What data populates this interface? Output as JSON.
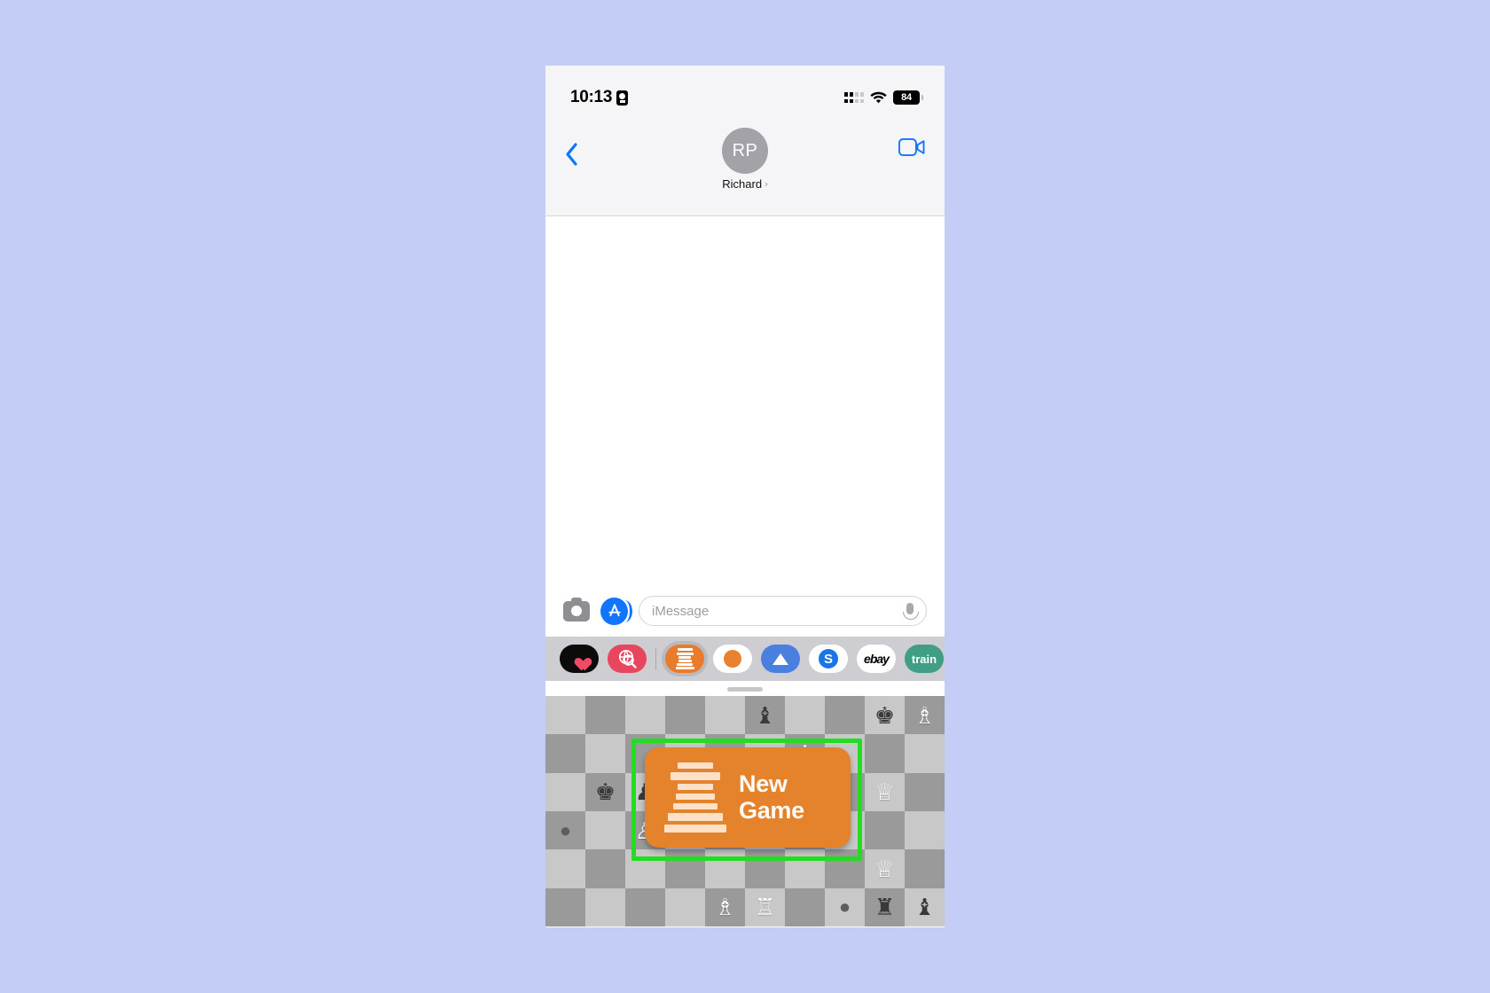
{
  "device": {
    "status_bar": {
      "time": "10:13",
      "time_icon": "record-badge-icon",
      "cellular_icon": "cellular-bars-icon",
      "wifi_icon": "wifi-icon",
      "battery_level": "84"
    },
    "home_indicator": "home-indicator"
  },
  "header": {
    "back_icon": "chevron-left-icon",
    "avatar_initials": "RP",
    "contact_name": "Richard",
    "contact_chevron": "›",
    "facetime_icon": "video-camera-icon"
  },
  "conversation": {
    "messages": []
  },
  "input_bar": {
    "camera_icon": "camera-icon",
    "appstore_icon": "app-store-icon",
    "message_placeholder": "iMessage",
    "message_value": "",
    "mic_icon": "microphone-icon"
  },
  "app_drawer": {
    "items": [
      {
        "name": "apple-music-icon",
        "label": "",
        "bg": "#0b0b0b",
        "selected": false
      },
      {
        "name": "app-store-search-icon",
        "label": "",
        "bg": "#e8465f",
        "selected": false
      },
      {
        "name": "chess-rook-icon",
        "label": "",
        "bg": "#ea7b2a",
        "selected": true
      },
      {
        "name": "orange-circle-app-icon",
        "label": "",
        "bg": "#ffffff",
        "selected": false
      },
      {
        "name": "nordvpn-icon",
        "label": "",
        "bg": "#4a7fe0",
        "selected": false
      },
      {
        "name": "shazam-icon",
        "label": "",
        "bg": "#ffffff",
        "selected": false
      },
      {
        "name": "ebay-icon",
        "label": "ebay",
        "bg": "#ffffff",
        "selected": false
      },
      {
        "name": "trainline-icon",
        "label": "train",
        "bg": "#3f9e85",
        "selected": false
      }
    ]
  },
  "chess_extension": {
    "grabber": "drag-handle",
    "new_game": {
      "label": "New\nGame",
      "label_line1": "New",
      "label_line2": "Game",
      "icon": "chess-rook-icon",
      "button_color": "#e5832c",
      "highlight_color": "#22dd22"
    },
    "board": {
      "light_square": "#c8c8c8",
      "dark_square": "#9a9a9a",
      "columns": 10,
      "rows": 6,
      "pieces": [
        {
          "row": 0,
          "col": 5,
          "glyph": "♝",
          "side": "black",
          "name": "black-bishop"
        },
        {
          "row": 0,
          "col": 8,
          "glyph": "♚",
          "side": "black",
          "name": "black-king"
        },
        {
          "row": 0,
          "col": 9,
          "glyph": "♗",
          "side": "white",
          "name": "white-bishop"
        },
        {
          "row": 1,
          "col": 6,
          "glyph": "♔",
          "side": "white",
          "name": "white-king"
        },
        {
          "row": 2,
          "col": 1,
          "glyph": "♚",
          "side": "black",
          "name": "black-king"
        },
        {
          "row": 2,
          "col": 2,
          "glyph": "♟",
          "side": "black",
          "name": "black-pawn"
        },
        {
          "row": 2,
          "col": 8,
          "glyph": "♕",
          "side": "white",
          "name": "white-queen"
        },
        {
          "row": 3,
          "col": 0,
          "glyph": "●",
          "side": "bomb",
          "name": "bomb-piece"
        },
        {
          "row": 3,
          "col": 2,
          "glyph": "♙",
          "side": "white",
          "name": "white-pawn"
        },
        {
          "row": 4,
          "col": 8,
          "glyph": "♕",
          "side": "white",
          "name": "white-queen"
        },
        {
          "row": 5,
          "col": 4,
          "glyph": "♗",
          "side": "white",
          "name": "white-bishop"
        },
        {
          "row": 5,
          "col": 5,
          "glyph": "♖",
          "side": "white",
          "name": "white-rook"
        },
        {
          "row": 5,
          "col": 7,
          "glyph": "●",
          "side": "bomb",
          "name": "bomb-piece"
        },
        {
          "row": 5,
          "col": 8,
          "glyph": "♜",
          "side": "black",
          "name": "black-rook"
        },
        {
          "row": 5,
          "col": 9,
          "glyph": "♝",
          "side": "black",
          "name": "black-bishop"
        }
      ]
    }
  }
}
